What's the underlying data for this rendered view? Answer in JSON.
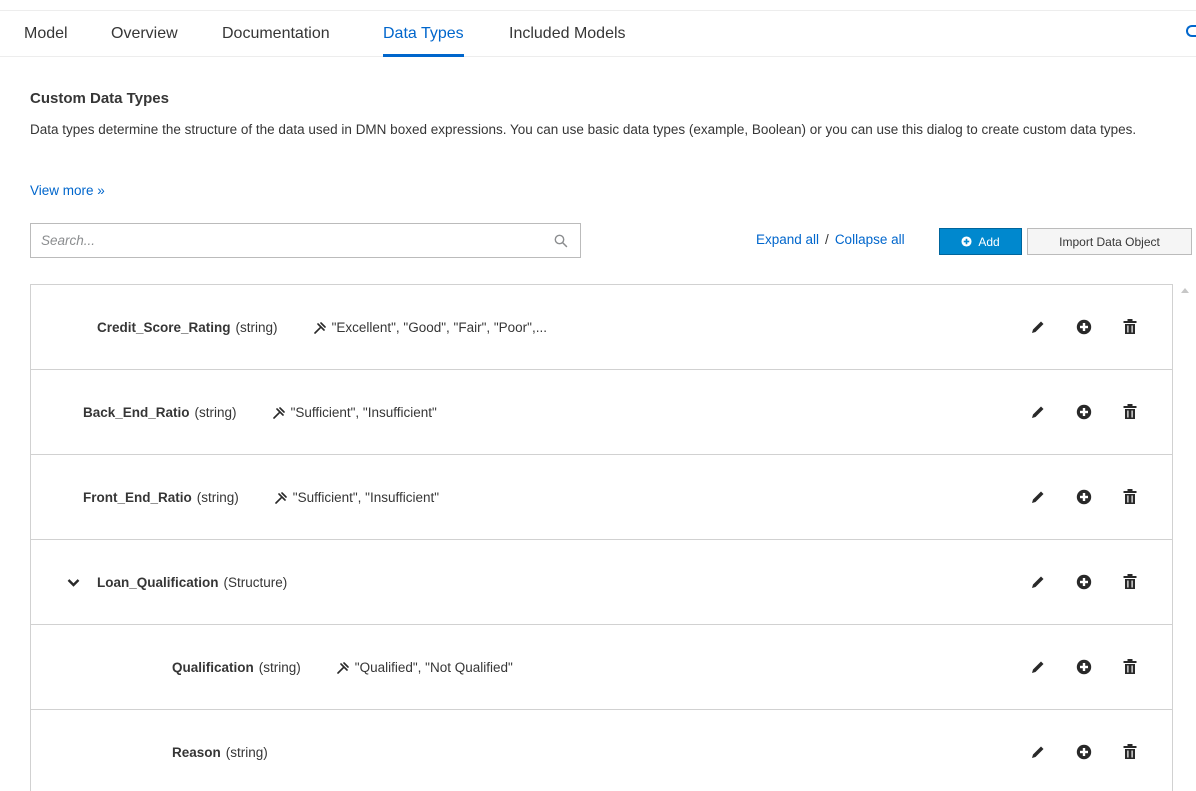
{
  "tabs": [
    {
      "label": "Model",
      "active": false
    },
    {
      "label": "Overview",
      "active": false
    },
    {
      "label": "Documentation",
      "active": false
    },
    {
      "label": "Data Types",
      "active": true
    },
    {
      "label": "Included Models",
      "active": false
    }
  ],
  "section": {
    "title": "Custom Data Types",
    "description": "Data types determine the structure of the data used in DMN boxed expressions. You can use basic data types (example, Boolean) or you can use this dialog to create custom data types.",
    "view_more": "View more »"
  },
  "search": {
    "placeholder": "Search...",
    "value": ""
  },
  "toolbar": {
    "expand_all": "Expand all",
    "separator": "/",
    "collapse_all": "Collapse all",
    "add_label": "Add",
    "import_label": "Import Data Object"
  },
  "data_types": [
    {
      "name": "Credit_Score_Rating",
      "type": "(string)",
      "constraint": "\"Excellent\", \"Good\", \"Fair\", \"Poor\",...",
      "level": 0,
      "expandable": false
    },
    {
      "name": "Back_End_Ratio",
      "type": "(string)",
      "constraint": "\"Sufficient\", \"Insufficient\"",
      "level": 0,
      "expandable": false
    },
    {
      "name": "Front_End_Ratio",
      "type": "(string)",
      "constraint": "\"Sufficient\", \"Insufficient\"",
      "level": 0,
      "expandable": false
    },
    {
      "name": "Loan_Qualification",
      "type": "(Structure)",
      "constraint": "",
      "level": 0,
      "expandable": true,
      "expanded": true
    },
    {
      "name": "Qualification",
      "type": "(string)",
      "constraint": "\"Qualified\", \"Not Qualified\"",
      "level": 1,
      "expandable": false
    },
    {
      "name": "Reason",
      "type": "(string)",
      "constraint": "",
      "level": 1,
      "expandable": false
    }
  ],
  "icons": {
    "row_actions": [
      "pencil-icon",
      "plus-circle-icon",
      "trash-icon"
    ],
    "constraint": "constraint-icon",
    "search": "search-icon",
    "expand": "chevron-down-icon"
  },
  "colors": {
    "accent": "#0066cc",
    "primary_button": "#0088ce",
    "icon": "#292929"
  }
}
